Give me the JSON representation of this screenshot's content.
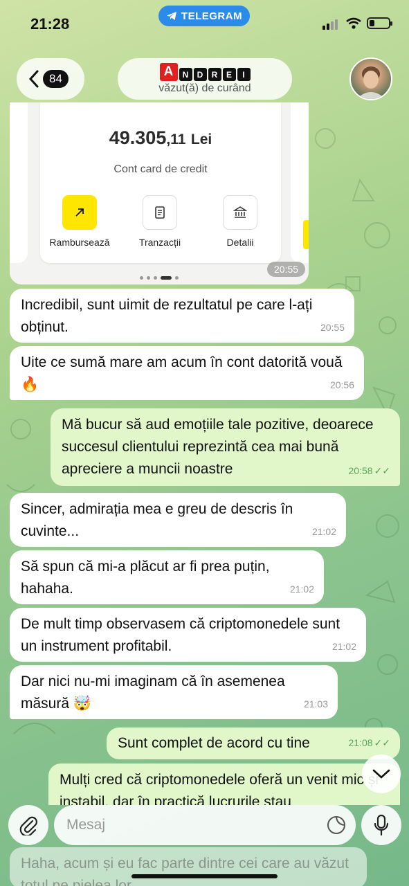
{
  "status_bar": {
    "time": "21:28",
    "app_pill": "TELEGRAM"
  },
  "header": {
    "back_count": "84",
    "contact_first_letter": "A",
    "contact_letters": [
      "N",
      "D",
      "R",
      "E",
      "I"
    ],
    "subtitle": "văzut(ă) de curând"
  },
  "image_message": {
    "amount_main": "49.305",
    "amount_decimals": ",11",
    "currency": "Lei",
    "card_label": "Cont card de credit",
    "actions": [
      {
        "label": "Rambursează",
        "icon": "arrow-up-right-icon"
      },
      {
        "label": "Tranzacții",
        "icon": "document-icon"
      },
      {
        "label": "Detalii",
        "icon": "bank-icon"
      }
    ],
    "time": "20:55"
  },
  "messages": [
    {
      "dir": "in",
      "text": "Incredibil, sunt uimit de rezultatul pe care l-ați obținut.",
      "time": "20:55"
    },
    {
      "dir": "in",
      "text": "Uite ce sumă mare am acum în cont datorită vouă 🔥",
      "time": "20:56"
    },
    {
      "dir": "out",
      "text": "Mă bucur să aud emoțiile tale pozitive, deoarece succesul clientului reprezintă cea mai bună apreciere a muncii noastre",
      "time": "20:58"
    },
    {
      "dir": "in",
      "text": "Sincer, admirația mea e greu de descris în cuvinte...",
      "time": "21:02"
    },
    {
      "dir": "in",
      "text": "Să spun că mi-a plăcut ar fi prea puțin, hahaha.",
      "time": "21:02"
    },
    {
      "dir": "in",
      "text": "De mult timp observasem că criptomonedele sunt un instrument profitabil.",
      "time": "21:02"
    },
    {
      "dir": "in",
      "text": "Dar nici nu-mi imaginam că în asemenea măsură 🤯",
      "time": "21:03"
    },
    {
      "dir": "out",
      "text": "Sunt complet de acord cu tine",
      "time": "21:08"
    },
    {
      "dir": "out",
      "text": "Mulți cred că criptomonedele oferă un venit mic și instabil, dar în practică lucrurile stau",
      "time": ""
    }
  ],
  "input": {
    "placeholder": "Mesaj"
  },
  "faded_message": "Haha, acum și eu fac parte dintre cei care au văzut totul pe pielea lor",
  "colors": {
    "incoming": "#ffffff",
    "outgoing": "#e1f7ca",
    "accent_time": "#5aa65a",
    "telegram_pill": "#2a8be8"
  }
}
